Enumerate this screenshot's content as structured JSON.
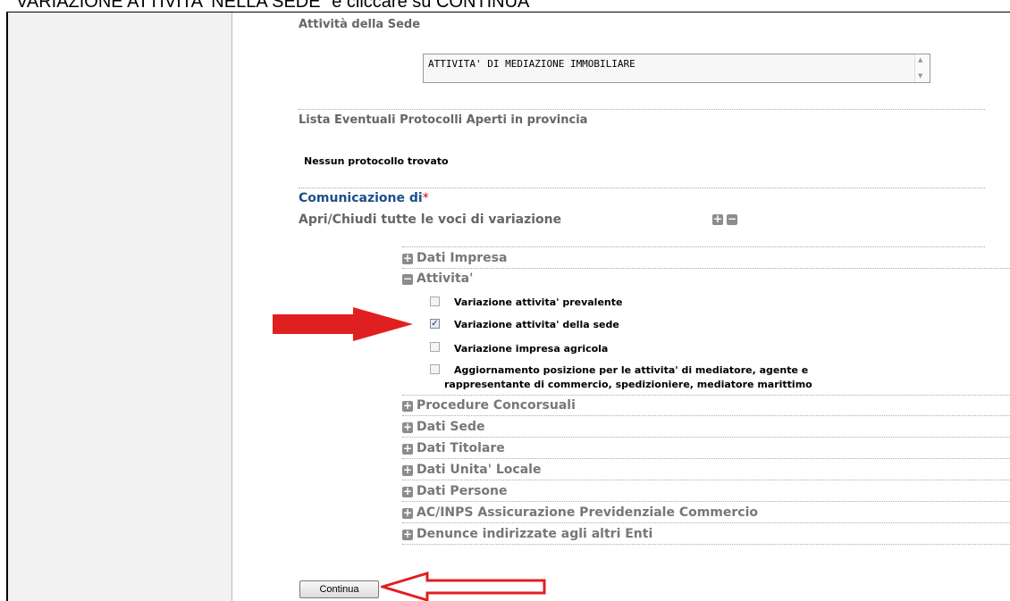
{
  "caption": "VARIAZIONE ATTIVITA' NELLA SEDE\" e cliccare su CONTINUA\"",
  "sections": {
    "attivita_sede_title": "Attività della Sede",
    "activity_value": "ATTIVITA' DI MEDIAZIONE IMMOBILIARE",
    "protocolli_title": "Lista Eventuali Protocolli Aperti in provincia",
    "no_protocols": "Nessun protocollo trovato",
    "comunicazione_label": "Comunicazione di",
    "required_mark": "*",
    "toggle_all_label": "Apri/Chiudi tutte le voci di variazione"
  },
  "tree": {
    "dati_impresa": "Dati Impresa",
    "attivita": "Attivita'",
    "options": [
      {
        "label": "Variazione attivita' prevalente",
        "checked": false
      },
      {
        "label": "Variazione attivita' della sede",
        "checked": true
      },
      {
        "label": "Variazione impresa agricola",
        "checked": false
      },
      {
        "label_line1": "Aggiornamento posizione per le attivita' di mediatore, agente e",
        "label_line2": "rappresentante di commercio, spedizioniere, mediatore marittimo",
        "checked": false
      }
    ],
    "procedure": "Procedure Concorsuali",
    "dati_sede": "Dati Sede",
    "dati_titolare": "Dati Titolare",
    "dati_unita": "Dati Unita' Locale",
    "dati_persone": "Dati Persone",
    "ac_inps": "AC/INPS Assicurazione Previdenziale Commercio",
    "denunce": "Denunce indirizzate agli altri Enti"
  },
  "buttons": {
    "continua": "Continua"
  },
  "icons": {
    "plus": "+",
    "minus": "−",
    "check": "✓",
    "scroll_up": "▲",
    "scroll_down": "▼"
  },
  "colors": {
    "arrow_fill": "#e02020",
    "link_blue": "#1a4f8a",
    "required_red": "#dd0000"
  }
}
